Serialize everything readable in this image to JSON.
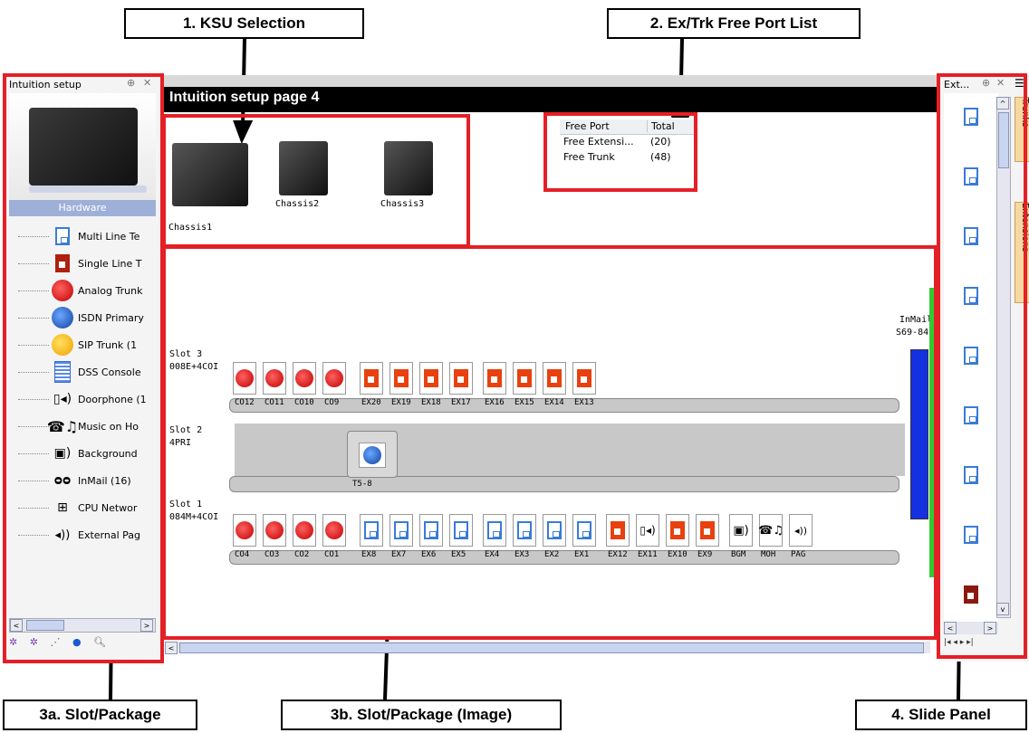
{
  "callouts": {
    "ksu": "1. KSU Selection",
    "freeport": "2. Ex/Trk Free Port List",
    "slot_list": "3a. Slot/Package",
    "slot_image": "3b. Slot/Package (Image)",
    "slide": "4. Slide Panel"
  },
  "left_pane": {
    "title": "Intuition setup",
    "pin": "⊕",
    "close": "✕",
    "hardware_label": "Hardware",
    "items": [
      {
        "label": "Multi Line Te",
        "icon": "multi-line-phone-icon"
      },
      {
        "label": "Single Line T",
        "icon": "single-line-phone-icon"
      },
      {
        "label": "Analog Trunk",
        "icon": "analog-trunk-globe-icon"
      },
      {
        "label": "ISDN Primary",
        "icon": "isdn-globe-icon"
      },
      {
        "label": "SIP Trunk (1",
        "icon": "sip-globe-icon"
      },
      {
        "label": "DSS Console",
        "icon": "dss-console-icon"
      },
      {
        "label": "Doorphone (1",
        "icon": "doorphone-icon"
      },
      {
        "label": "Music on Ho",
        "icon": "music-on-hold-icon"
      },
      {
        "label": "Background",
        "icon": "background-music-icon"
      },
      {
        "label": "InMail (16)",
        "icon": "inmail-icon"
      },
      {
        "label": "CPU Networ",
        "icon": "cpu-network-icon"
      },
      {
        "label": "External Pag",
        "icon": "external-paging-icon"
      }
    ]
  },
  "main": {
    "title": "Intuition setup page 4",
    "chassis": [
      "Chassis1",
      "Chassis2",
      "Chassis3"
    ],
    "freeport": {
      "headers": [
        "Free Port",
        "Total"
      ],
      "rows": [
        [
          "Free Extensi...",
          "(20)"
        ],
        [
          "Free Trunk",
          "(48)"
        ]
      ]
    },
    "slot3": {
      "name": "Slot 3",
      "pkg": "008E+4COI",
      "ports": [
        "CO12",
        "CO11",
        "CO10",
        "CO9",
        "EX20",
        "EX19",
        "EX18",
        "EX17",
        "EX16",
        "EX15",
        "EX14",
        "EX13"
      ]
    },
    "slot2": {
      "name": "Slot 2",
      "pkg": "4PRI",
      "ports": [
        "T5-8"
      ]
    },
    "slot1": {
      "name": "Slot 1",
      "pkg": "084M+4COI",
      "ports": [
        "CO4",
        "CO3",
        "CO2",
        "CO1",
        "EX8",
        "EX7",
        "EX6",
        "EX5",
        "EX4",
        "EX3",
        "EX2",
        "EX1",
        "EX12",
        "EX11",
        "EX10",
        "EX9",
        "BGM",
        "MOH",
        "PAG"
      ]
    },
    "inmail_label": "InMail",
    "inmail_sub": "S69-84"
  },
  "right_pane": {
    "title": "Ext...",
    "pin": "⊕",
    "close": "✕",
    "tabs": [
      "Trunks",
      "Extensions"
    ]
  },
  "colors": {
    "frame": "#e32026",
    "titlebar": "#000000",
    "phone_blue": "#3a7bd5",
    "phone_red": "#e8410f"
  }
}
